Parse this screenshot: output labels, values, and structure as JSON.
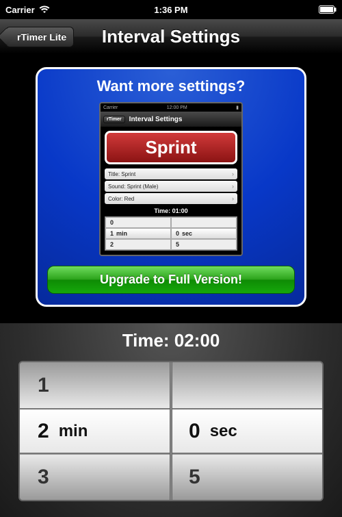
{
  "status": {
    "carrier": "Carrier",
    "time": "1:36 PM"
  },
  "nav": {
    "back_label": "rTimer Lite",
    "title": "Interval Settings"
  },
  "promo": {
    "heading": "Want more settings?",
    "upgrade_label": "Upgrade to Full Version!",
    "mini": {
      "status_carrier": "Carrier",
      "status_time": "12:00 PM",
      "nav_back": "rTimer",
      "nav_title": "Interval Settings",
      "sprint_label": "Sprint",
      "row_title": "Title: Sprint",
      "row_sound": "Sound: Sprint (Male)",
      "row_color": "Color: Red",
      "time_label": "Time: 01:00",
      "picker_left": [
        "0",
        "1",
        "2"
      ],
      "picker_right": [
        "",
        "0",
        "5"
      ],
      "unit_min": "min",
      "unit_sec": "sec"
    }
  },
  "time": {
    "label": "Time: 02:00",
    "left_values": [
      "1",
      "2",
      "3"
    ],
    "right_values": [
      "",
      "0",
      "5"
    ],
    "unit_min": "min",
    "unit_sec": "sec"
  }
}
